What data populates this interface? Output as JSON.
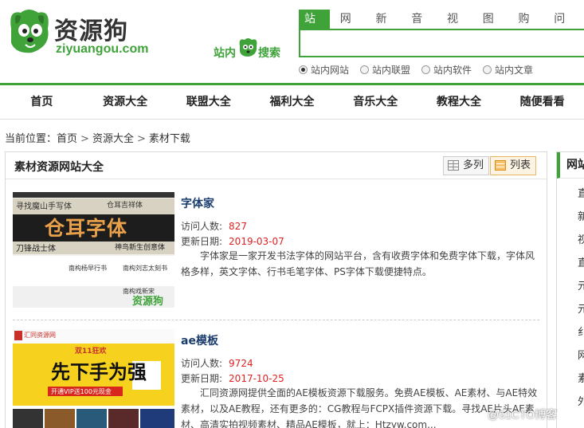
{
  "logo": {
    "cn": "资源狗",
    "url": "ziyuangou.com"
  },
  "site_search": {
    "left": "站内",
    "right": "搜索"
  },
  "search": {
    "tabs": [
      "站内",
      "网页",
      "新闻",
      "音乐",
      "视频",
      "图片",
      "购物",
      "问答"
    ],
    "active_tab": 0,
    "value": "",
    "radios": [
      "站内网站",
      "站内联盟",
      "站内软件",
      "站内文章"
    ],
    "checked_radio": 0
  },
  "nav": [
    "首页",
    "资源大全",
    "联盟大全",
    "福利大全",
    "音乐大全",
    "教程大全",
    "随便看看"
  ],
  "breadcrumb": {
    "prefix": "当前位置：",
    "items": [
      "首页",
      "资源大全",
      "素材下载"
    ],
    "sep": ">"
  },
  "main": {
    "title": "素材资源网站大全",
    "view_grid": "多列",
    "view_list": "列表",
    "visits_label": "访问人数:",
    "date_label": "更新日期:",
    "items": [
      {
        "name": "字体家",
        "visits": "827",
        "date": "2019-03-07",
        "desc": "字体家是一家开发书法字体的网站平台，含有收费字体和免费字体下载，字体风格多样，英文字体、行书毛笔字体、PS字体下载便捷特点。",
        "thumb": {
          "brand": "资源狗",
          "headline": "仓耳字体",
          "lines": [
            "寻找魔山手写体",
            "刀锋战士体",
            "南构杨早行书",
            "南构刘志太刻书",
            "南构戏新宋",
            "仓耳吉祥体",
            "神鸟新生创意体"
          ]
        }
      },
      {
        "name": "ae模板",
        "visits": "9724",
        "date": "2017-10-25",
        "desc": "汇同资源网提供全面的AE模板资源下载服务。免费AE模板、AE素材、与AE特效素材，以及AE教程，还有更多的：CG教程与FCPX插件资源下载。寻找AE片头AE素材、高清实拍视频素材、精品AE模板，就上：Htzyw.com...",
        "thumb": {
          "brand": "汇同资源网",
          "headline": "先下手为强",
          "badge": "开通VIP送100元现金",
          "sub": "双11狂欢"
        }
      }
    ]
  },
  "sidebar": {
    "title": "网站",
    "items": [
      "直",
      "新",
      "视",
      "直",
      "元",
      "元",
      "纟",
      "网",
      "素",
      "外"
    ]
  },
  "watermark": "@51CTO博客",
  "colors": {
    "accent": "#3fa33a",
    "link": "#1a3d6d",
    "value": "#dd2222"
  }
}
